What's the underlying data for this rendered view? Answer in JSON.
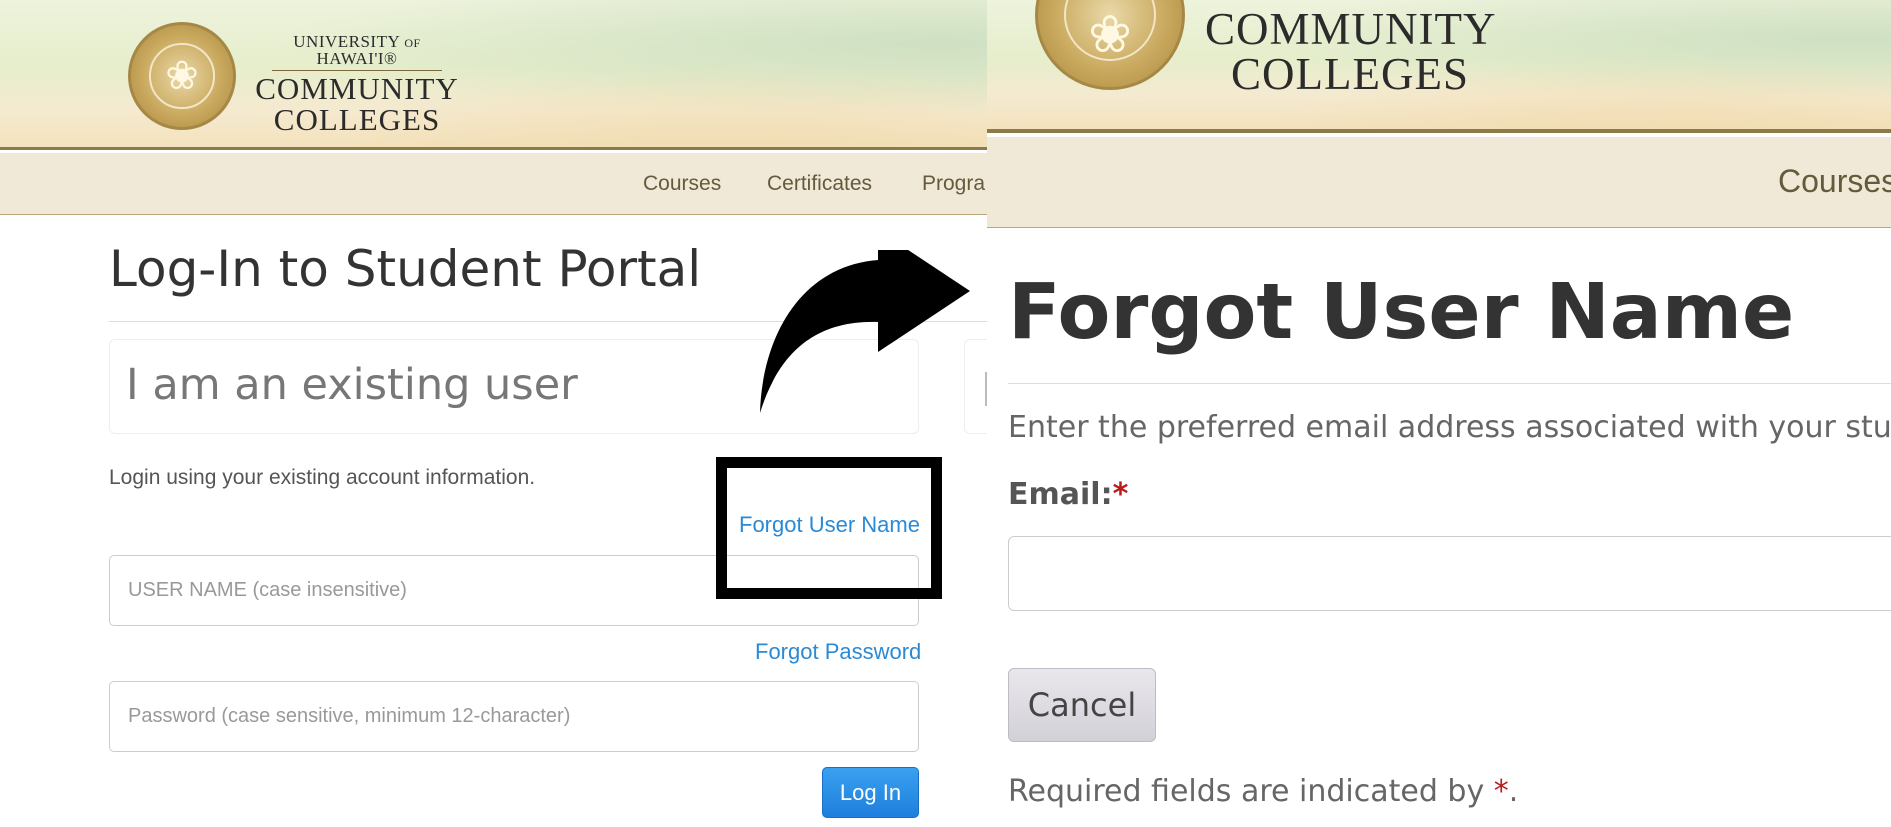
{
  "left": {
    "logo": {
      "university": "UNIVERSITY of HAWAI'I®",
      "line1": "COMMUNITY",
      "line2": "COLLEGES"
    },
    "nav": [
      "Courses",
      "Certificates",
      "Progra"
    ],
    "page_title": "Log-In to Student Portal",
    "panel_title": "I am an existing user",
    "help_text": "Login using your existing account information.",
    "forgot_user_link": "Forgot User Name",
    "username_placeholder": "USER NAME (case insensitive)",
    "forgot_password_link": "Forgot Password",
    "password_placeholder": "Password (case sensitive, minimum 12-character)",
    "login_button": "Log In"
  },
  "right": {
    "logo": {
      "line1": "COMMUNITY",
      "line2": "COLLEGES"
    },
    "nav": [
      "Courses"
    ],
    "page_title": "Forgot User Name",
    "help_text": "Enter the preferred email address associated with your student",
    "email_label": "Email:",
    "required_mark": "*",
    "cancel_button": "Cancel",
    "required_note_prefix": "Required fields are indicated by ",
    "required_note_suffix": "."
  },
  "annotations": {
    "arrow_icon": "curved-arrow-icon",
    "highlight_color": "#000000"
  },
  "colors": {
    "link": "#2a8ad6",
    "login_button": "#1e7fdc",
    "nav_bg": "#f0e9d8",
    "required": "#b71c1c"
  }
}
